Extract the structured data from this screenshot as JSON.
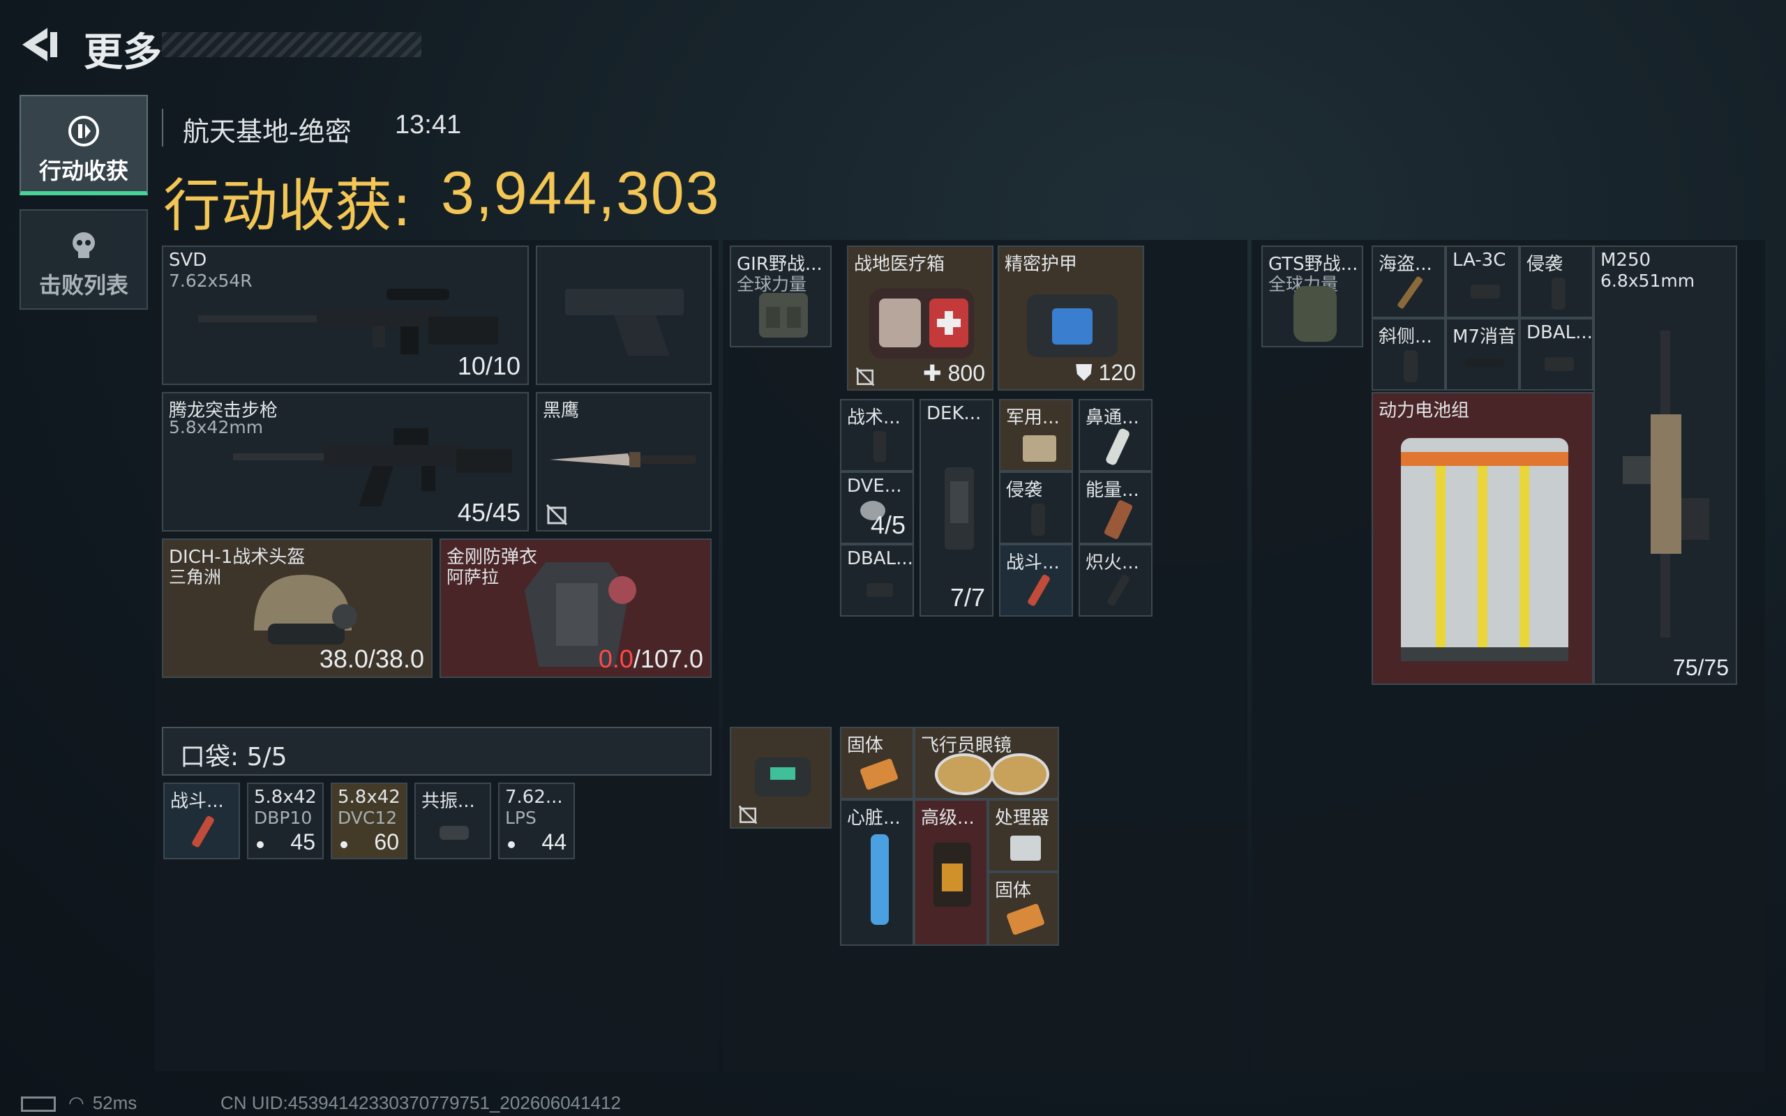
{
  "header": {
    "title": "更多"
  },
  "sidebar": {
    "tabs": [
      {
        "label": "行动收获",
        "icon": "loot-icon",
        "active": true
      },
      {
        "label": "击败列表",
        "icon": "skull-icon",
        "active": false
      }
    ]
  },
  "match": {
    "map": "航天基地-绝密",
    "time": "13:41"
  },
  "haul": {
    "label": "行动收获:",
    "value": "3,944,303"
  },
  "loadout": {
    "primary": {
      "name": "SVD",
      "ammo": "7.62x54R",
      "count": "10/10"
    },
    "secondary": {
      "name": "腾龙突击步枪",
      "ammo": "5.8x42mm",
      "count": "45/45"
    },
    "melee": {
      "name": "黑鹰"
    },
    "helmet": {
      "name": "DICH-1战术头盔",
      "maker": "三角洲",
      "durability": "38.0/38.0"
    },
    "armor": {
      "name": "金刚防弹衣",
      "maker": "阿萨拉",
      "durability_current": "0.0",
      "durability_max": "/107.0"
    }
  },
  "pocket": {
    "label": "口袋: 5/5",
    "items": [
      {
        "name": "战斗...",
        "sub": "",
        "count": ""
      },
      {
        "name": "5.8x42",
        "sub": "DBP10",
        "count": "45"
      },
      {
        "name": "5.8x42",
        "sub": "DVC12",
        "count": "60"
      },
      {
        "name": "共振...",
        "sub": "",
        "count": ""
      },
      {
        "name": "7.62...",
        "sub": "LPS",
        "count": "44"
      }
    ]
  },
  "rig": {
    "name": "GIR野战...",
    "maker": "全球力量",
    "medkit": {
      "name": "战地医疗箱",
      "count": "800"
    },
    "armor_plate": {
      "name": "精密护甲",
      "count": "120"
    },
    "grid": [
      {
        "name": "战术..."
      },
      {
        "name": "DEK...",
        "count": "7/7"
      },
      {
        "name": "军用..."
      },
      {
        "name": "鼻通..."
      },
      {
        "name": "DVE...",
        "count": "4/5"
      },
      {
        "name": "侵袭"
      },
      {
        "name": "能量..."
      },
      {
        "name": "DBAL..."
      },
      {
        "name": "战斗..."
      },
      {
        "name": "炽火..."
      }
    ]
  },
  "case": {
    "items": [
      {
        "name": "固体"
      },
      {
        "name": "飞行员眼镜"
      },
      {
        "name": "心脏..."
      },
      {
        "name": "高级..."
      },
      {
        "name": "处理器"
      },
      {
        "name": "固体"
      }
    ]
  },
  "backpack": {
    "name": "GTS野战...",
    "maker": "全球力量",
    "grid": [
      {
        "name": "海盗..."
      },
      {
        "name": "LA-3C"
      },
      {
        "name": "侵袭"
      },
      {
        "name": "斜侧..."
      },
      {
        "name": "M7消音"
      },
      {
        "name": "DBAL..."
      }
    ],
    "battery": {
      "name": "动力电池组"
    },
    "weapon": {
      "name": "M250",
      "ammo": "6.8x51mm",
      "count": "75/75"
    }
  },
  "status": {
    "ping": "52ms",
    "uid": "CN UID:45394142330370779751_202606041412"
  }
}
